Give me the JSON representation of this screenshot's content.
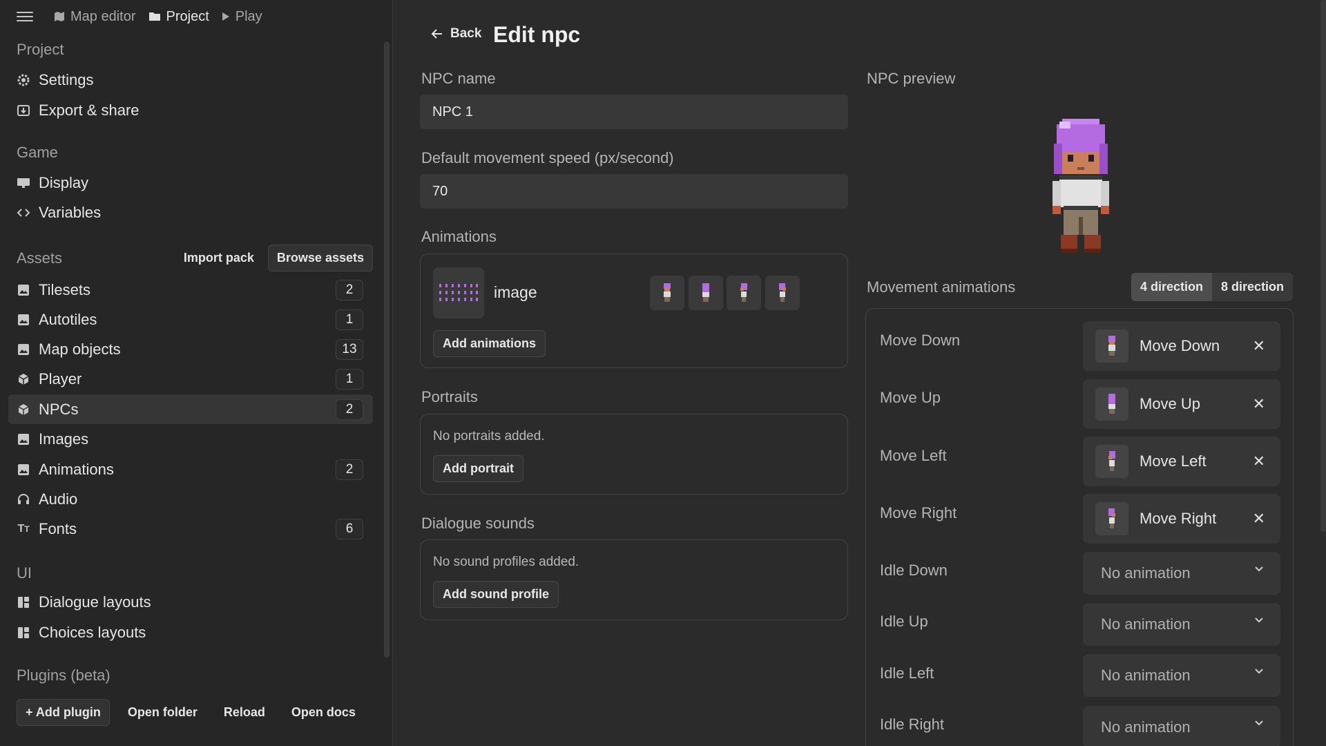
{
  "topbar": {
    "map_editor": "Map editor",
    "project": "Project",
    "play": "Play"
  },
  "sidebar": {
    "project_section": "Project",
    "settings": "Settings",
    "export": "Export & share",
    "game_section": "Game",
    "display": "Display",
    "variables": "Variables",
    "assets_section": "Assets",
    "import_pack": "Import pack",
    "browse_assets": "Browse assets",
    "assets": [
      {
        "label": "Tilesets",
        "count": "2"
      },
      {
        "label": "Autotiles",
        "count": "1"
      },
      {
        "label": "Map objects",
        "count": "13"
      },
      {
        "label": "Player",
        "count": "1"
      },
      {
        "label": "NPCs",
        "count": "2"
      },
      {
        "label": "Images",
        "count": ""
      },
      {
        "label": "Animations",
        "count": "2"
      },
      {
        "label": "Audio",
        "count": ""
      },
      {
        "label": "Fonts",
        "count": "6"
      }
    ],
    "ui_section": "UI",
    "dialogue_layouts": "Dialogue layouts",
    "choices_layouts": "Choices layouts",
    "plugins_section": "Plugins (beta)",
    "add_plugin": "+ Add plugin",
    "open_folder": "Open folder",
    "reload": "Reload",
    "open_docs": "Open docs"
  },
  "main": {
    "back": "Back",
    "title": "Edit npc",
    "npc_name_label": "NPC name",
    "npc_name_value": "NPC 1",
    "speed_label": "Default movement speed (px/second)",
    "speed_value": "70",
    "animations_label": "Animations",
    "animation_name": "image",
    "add_animations": "Add animations",
    "portraits_label": "Portraits",
    "no_portraits": "No portraits added.",
    "add_portrait": "Add portrait",
    "dialogue_sounds_label": "Dialogue sounds",
    "no_sounds": "No sound profiles added.",
    "add_sound_profile": "Add sound profile",
    "preview_label": "NPC preview",
    "movement_label": "Movement animations",
    "dir4": "4 direction",
    "dir8": "8 direction",
    "rows": [
      {
        "label": "Move Down",
        "value": "Move Down"
      },
      {
        "label": "Move Up",
        "value": "Move Up"
      },
      {
        "label": "Move Left",
        "value": "Move Left"
      },
      {
        "label": "Move Right",
        "value": "Move Right"
      },
      {
        "label": "Idle Down",
        "value": "No animation"
      },
      {
        "label": "Idle Up",
        "value": "No animation"
      },
      {
        "label": "Idle Left",
        "value": "No animation"
      },
      {
        "label": "Idle Right",
        "value": "No animation"
      }
    ]
  },
  "colors": {
    "background": "#2b2b2b",
    "sidebar": "#262626",
    "sprite_hair": "#b46ae0"
  }
}
